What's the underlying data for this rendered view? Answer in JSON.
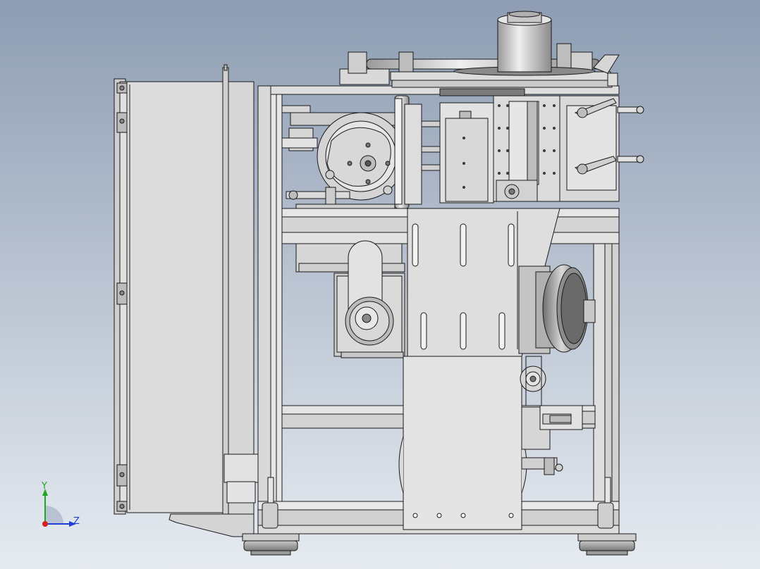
{
  "viewport": {
    "background_top": "#8e9db3",
    "background_bottom": "#e6ebf1",
    "part_fill": "#d8d8d8",
    "part_fill_light": "#ececec",
    "part_fill_dark": "#a9a9a9",
    "edge_color": "#1a1a1a"
  },
  "triad": {
    "x_axis_color": "#d42020",
    "y_axis_color": "#1fa81f",
    "z_axis_color": "#1f3fd6",
    "y_label": "Y",
    "z_label": "Z"
  }
}
